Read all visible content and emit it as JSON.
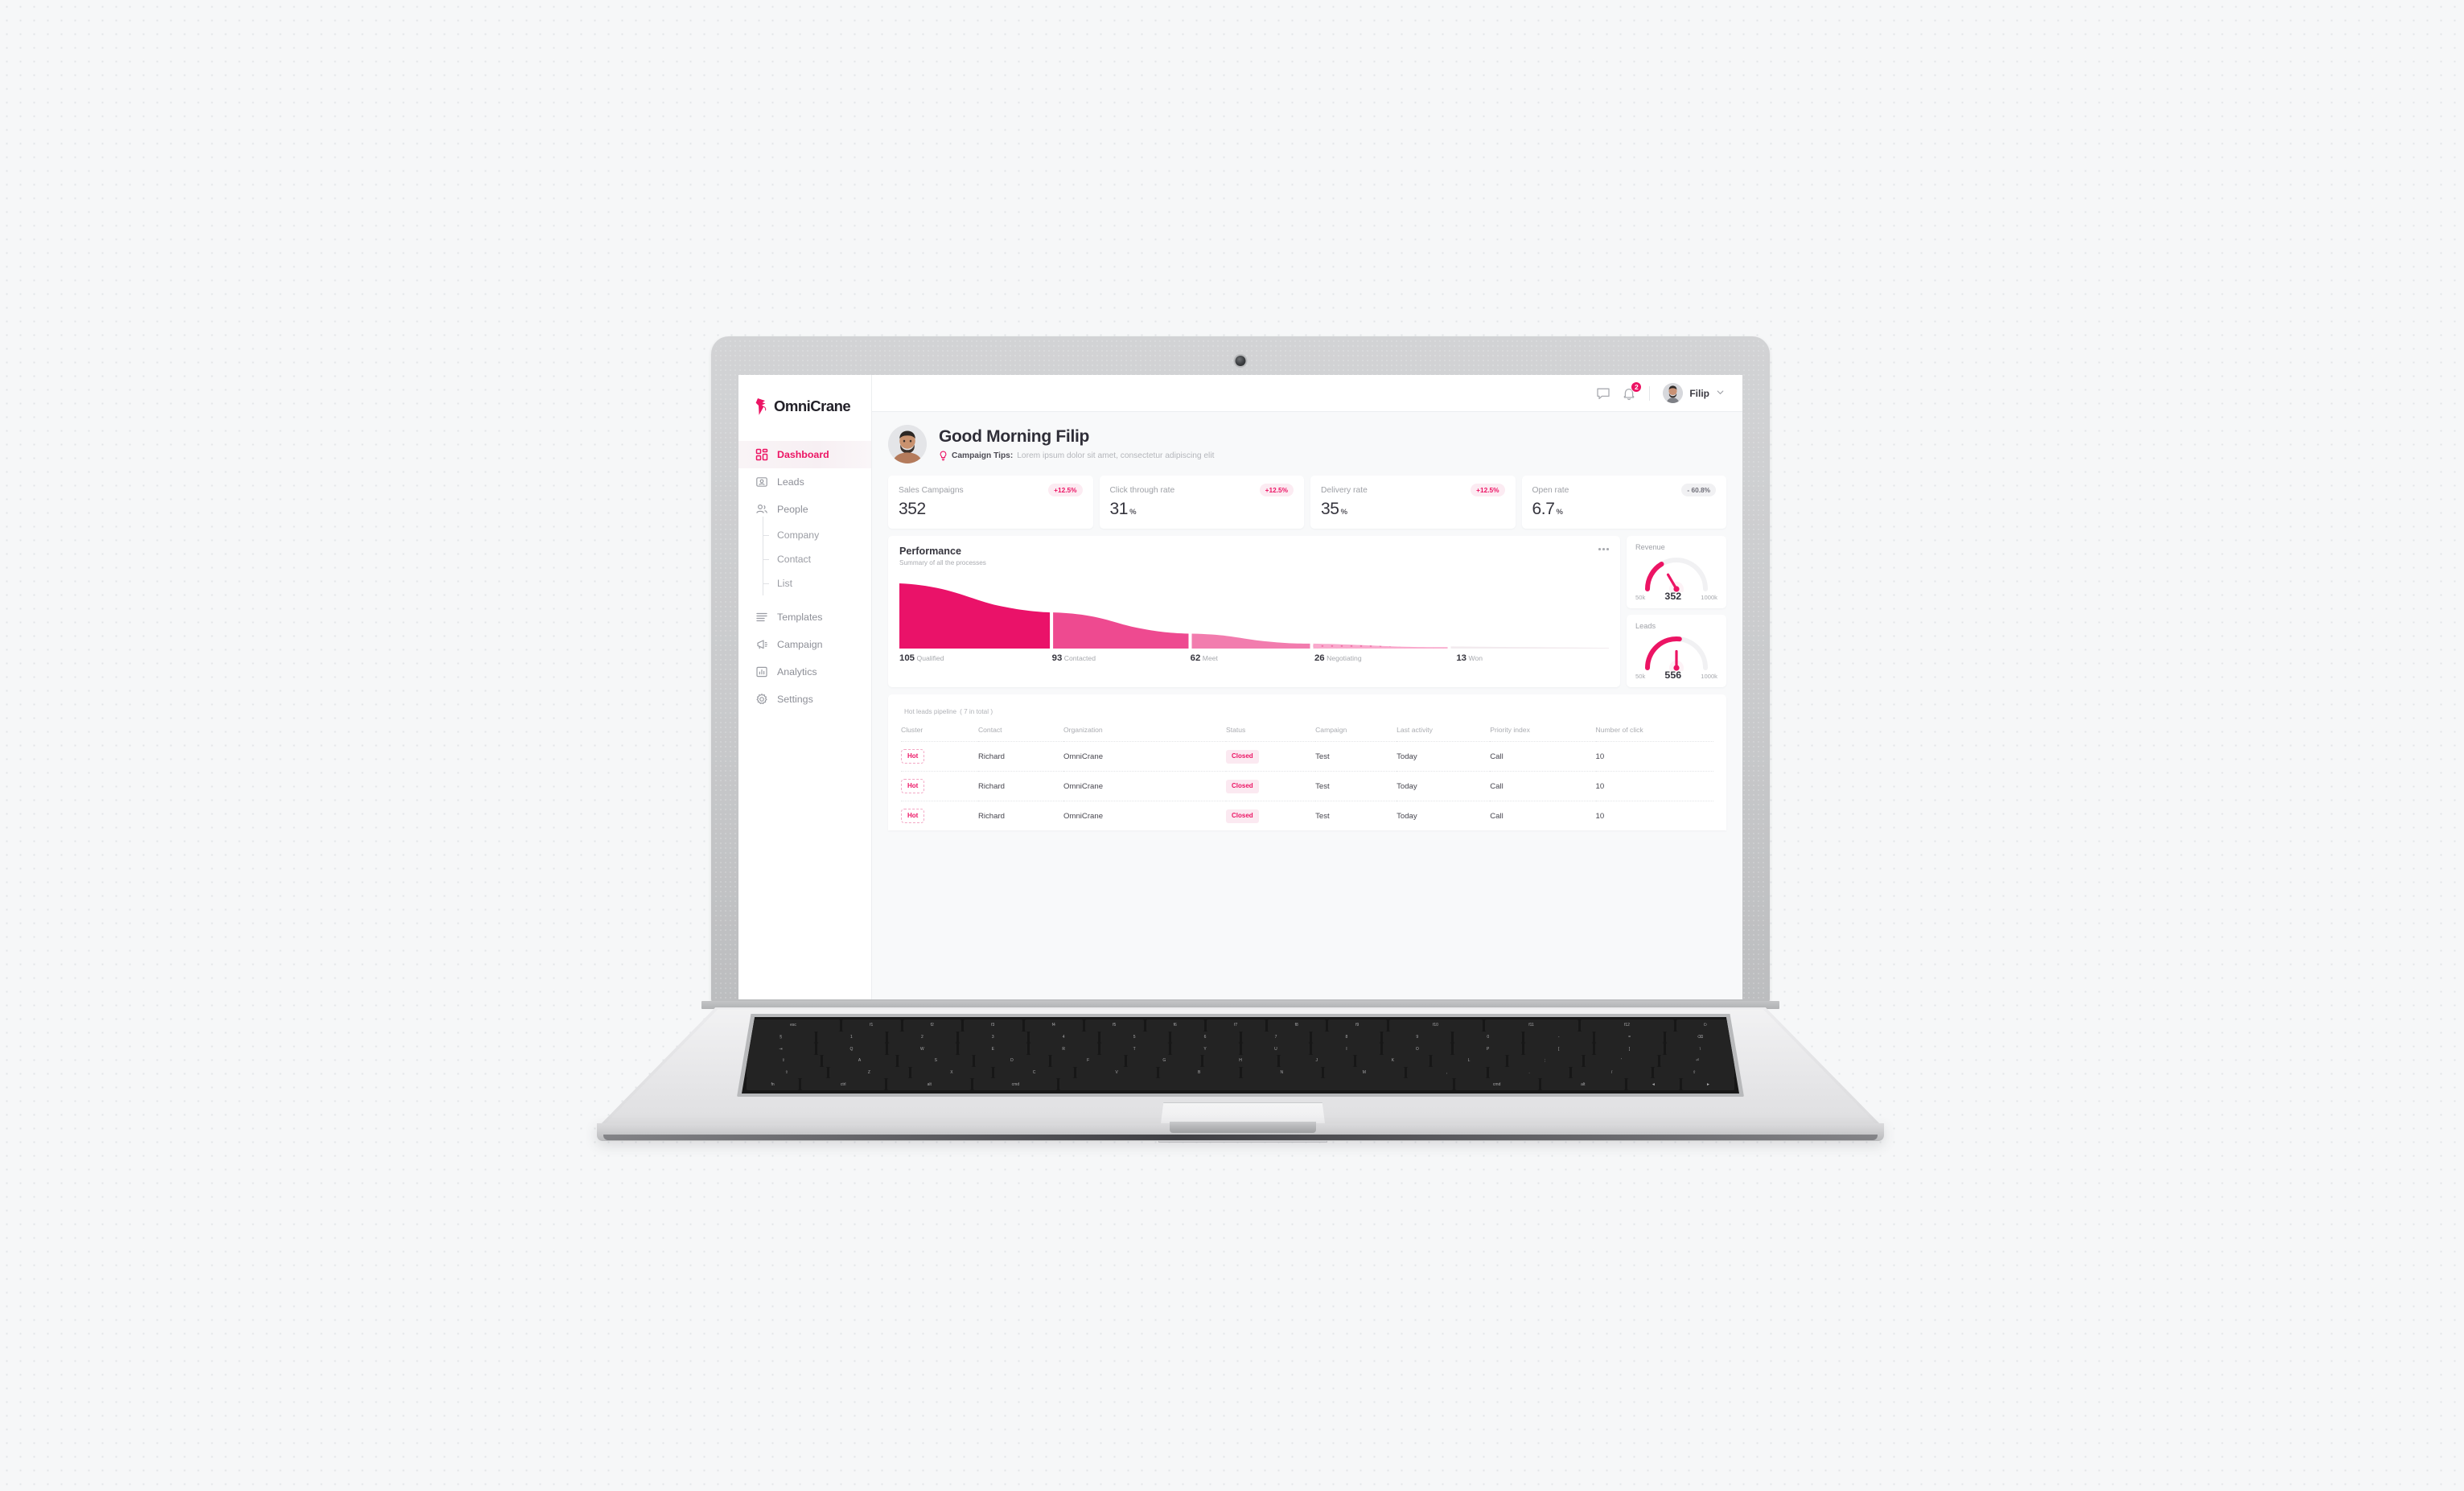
{
  "app": {
    "brand": "OmniCrane",
    "brand_color": "#ec1464"
  },
  "sidebar": {
    "items": [
      {
        "label": "Dashboard",
        "icon": "grid-icon",
        "active": true
      },
      {
        "label": "Leads",
        "icon": "id-card-icon",
        "active": false
      },
      {
        "label": "People",
        "icon": "people-icon",
        "active": false
      },
      {
        "label": "Templates",
        "icon": "lines-icon",
        "active": false
      },
      {
        "label": "Campaign",
        "icon": "megaphone-icon",
        "active": false
      },
      {
        "label": "Analytics",
        "icon": "bar-chart-icon",
        "active": false
      },
      {
        "label": "Settings",
        "icon": "gear-icon",
        "active": false
      }
    ],
    "sub_items": [
      {
        "label": "Company"
      },
      {
        "label": "Contact"
      },
      {
        "label": "List"
      }
    ]
  },
  "topbar": {
    "message_icon": "chat-bubble-icon",
    "notification_icon": "bell-icon",
    "notification_count": "2",
    "user_name": "Filip",
    "chevron_icon": "chevron-down-icon"
  },
  "greeting": {
    "title": "Good Morning Filip",
    "tip_label": "Campaign Tips:",
    "tip_text": "Lorem ipsum dolor sit amet, consectetur adipiscing elit",
    "tip_icon": "lightbulb-icon"
  },
  "kpis": [
    {
      "label": "Sales Campaigns",
      "value": "352",
      "unit": "",
      "delta": "+12.5%",
      "delta_tone": "pink"
    },
    {
      "label": "Click through rate",
      "value": "31",
      "unit": "%",
      "delta": "+12.5%",
      "delta_tone": "pink"
    },
    {
      "label": "Delivery rate",
      "value": "35",
      "unit": "%",
      "delta": "+12.5%",
      "delta_tone": "pink"
    },
    {
      "label": "Open rate",
      "value": "6.7",
      "unit": "%",
      "delta": "- 60.8%",
      "delta_tone": "neutral"
    }
  ],
  "performance": {
    "title": "Performance",
    "subtitle": "Summary of all the processes",
    "menu_icon": "more-horizontal-icon"
  },
  "gauges": [
    {
      "label": "Revenue",
      "value": "352",
      "min": "50k",
      "max": "1000k",
      "fraction": 0.32
    },
    {
      "label": "Leads",
      "value": "556",
      "min": "50k",
      "max": "1000k",
      "fraction": 0.52
    }
  ],
  "table": {
    "title": "Hot leads pipeline",
    "count_note": "( 7 in total )",
    "columns": [
      "Cluster",
      "Contact",
      "Organization",
      "Status",
      "Campaign",
      "Last activity",
      "Priority index",
      "Number of click"
    ],
    "rows": [
      {
        "cluster": "Hot",
        "contact": "Richard",
        "organization": "OmniCrane",
        "status": "Closed",
        "campaign": "Test",
        "last_activity": "Today",
        "priority_index": "Call",
        "clicks": "10"
      },
      {
        "cluster": "Hot",
        "contact": "Richard",
        "organization": "OmniCrane",
        "status": "Closed",
        "campaign": "Test",
        "last_activity": "Today",
        "priority_index": "Call",
        "clicks": "10"
      },
      {
        "cluster": "Hot",
        "contact": "Richard",
        "organization": "OmniCrane",
        "status": "Closed",
        "campaign": "Test",
        "last_activity": "Today",
        "priority_index": "Call",
        "clicks": "10"
      }
    ]
  },
  "chart_data": {
    "type": "bar",
    "title": "Performance",
    "subtitle": "Summary of all the processes",
    "categories": [
      "Qualified",
      "Contacted",
      "Meet",
      "Negotiating",
      "Won"
    ],
    "values": [
      105,
      93,
      62,
      26,
      13
    ],
    "colors": [
      "#ea1269",
      "#ee4a90",
      "#f27cae",
      "#f9a6ca",
      "#f2eaee"
    ],
    "xlabel": "",
    "ylabel": "",
    "ylim": [
      0,
      120
    ],
    "grid": false,
    "legend": "below-bars",
    "note": "Funnel-style area chart; each stage drawn as a shape whose height falls off toward the right."
  },
  "keyboard_rows": [
    [
      "esc",
      "f1",
      "f2",
      "f3",
      "f4",
      "f5",
      "f6",
      "f7",
      "f8",
      "f9",
      "f10",
      "f11",
      "f12",
      "⏻"
    ],
    [
      "§",
      "1",
      "2",
      "3",
      "4",
      "5",
      "6",
      "7",
      "8",
      "9",
      "0",
      "-",
      "=",
      "⌫"
    ],
    [
      "⇥",
      "Q",
      "W",
      "E",
      "R",
      "T",
      "Y",
      "U",
      "I",
      "O",
      "P",
      "[",
      "]",
      "\\"
    ],
    [
      "⇪",
      "A",
      "S",
      "D",
      "F",
      "G",
      "H",
      "J",
      "K",
      "L",
      ";",
      "'",
      "⏎"
    ],
    [
      "⇧",
      "Z",
      "X",
      "C",
      "V",
      "B",
      "N",
      "M",
      ",",
      ".",
      "/",
      "⇧"
    ],
    [
      "fn",
      "ctrl",
      "alt",
      "cmd",
      "",
      "cmd",
      "alt",
      "◄",
      "►"
    ]
  ]
}
